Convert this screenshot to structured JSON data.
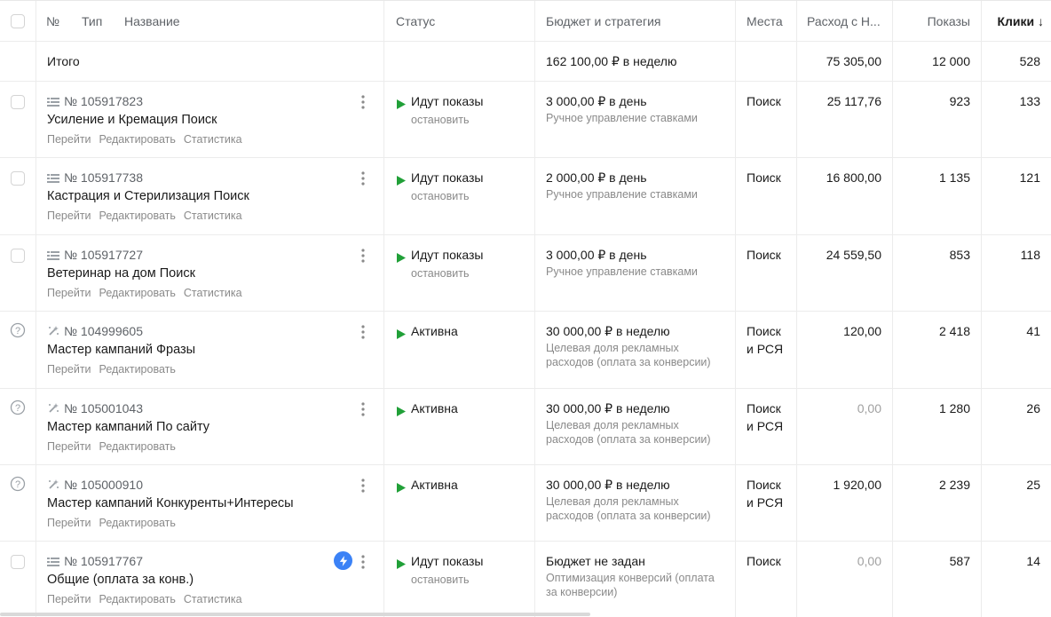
{
  "headers": {
    "no": "№",
    "type": "Тип",
    "name": "Название",
    "status": "Статус",
    "budget": "Бюджет и стратегия",
    "places": "Места",
    "spend": "Расход с Н...",
    "shows": "Показы",
    "clicks": "Клики ↓"
  },
  "total": {
    "label": "Итого",
    "budget": "162 100,00 ₽ в неделю",
    "spend": "75 305,00",
    "shows": "12 000",
    "clicks": "528"
  },
  "links": {
    "go": "Перейти",
    "edit": "Редактировать",
    "stats": "Статистика"
  },
  "rows": [
    {
      "id": "№ 105917823",
      "title": "Усиление и Кремация Поиск",
      "status": "Идут показы",
      "status_sub": "остановить",
      "budget": "3 000,00 ₽ в день",
      "budget_sub": "Ручное управление ставками",
      "places": "Поиск",
      "places2": "",
      "spend": "25 117,76",
      "shows": "923",
      "clicks": "133"
    },
    {
      "id": "№ 105917738",
      "title": "Кастрация и Стерилизация Поиск",
      "status": "Идут показы",
      "status_sub": "остановить",
      "budget": "2 000,00 ₽ в день",
      "budget_sub": "Ручное управление ставками",
      "places": "Поиск",
      "places2": "",
      "spend": "16 800,00",
      "shows": "1 135",
      "clicks": "121"
    },
    {
      "id": "№ 105917727",
      "title": "Ветеринар на дом Поиск",
      "status": "Идут показы",
      "status_sub": "остановить",
      "budget": "3 000,00 ₽ в день",
      "budget_sub": "Ручное управление ставками",
      "places": "Поиск",
      "places2": "",
      "spend": "24 559,50",
      "shows": "853",
      "clicks": "118"
    },
    {
      "id": "№ 104999605",
      "title": "Мастер кампаний Фразы",
      "status": "Активна",
      "status_sub": "",
      "budget": "30 000,00 ₽ в неделю",
      "budget_sub": "Целевая доля рекламных расходов (оплата за конверсии)",
      "places": "Поиск",
      "places2": "и РСЯ",
      "spend": "120,00",
      "shows": "2 418",
      "clicks": "41"
    },
    {
      "id": "№ 105001043",
      "title": "Мастер кампаний По сайту",
      "status": "Активна",
      "status_sub": "",
      "budget": "30 000,00 ₽ в неделю",
      "budget_sub": "Целевая доля рекламных расходов (оплата за конверсии)",
      "places": "Поиск",
      "places2": "и РСЯ",
      "spend": "0,00",
      "shows": "1 280",
      "clicks": "26"
    },
    {
      "id": "№ 105000910",
      "title": "Мастер кампаний Конкуренты+Интересы",
      "status": "Активна",
      "status_sub": "",
      "budget": "30 000,00 ₽ в неделю",
      "budget_sub": "Целевая доля рекламных расходов (оплата за конверсии)",
      "places": "Поиск",
      "places2": "и РСЯ",
      "spend": "1 920,00",
      "shows": "2 239",
      "clicks": "25"
    },
    {
      "id": "№ 105917767",
      "title": "Общие (оплата за конв.)",
      "status": "Идут показы",
      "status_sub": "остановить",
      "budget": "Бюджет не задан",
      "budget_sub": "Оптимизация конверсий (оплата за конверсии)",
      "places": "Поиск",
      "places2": "",
      "spend": "0,00",
      "shows": "587",
      "clicks": "14"
    }
  ],
  "colors": {
    "play": "#21a038",
    "bolt": "#3b82f6"
  }
}
